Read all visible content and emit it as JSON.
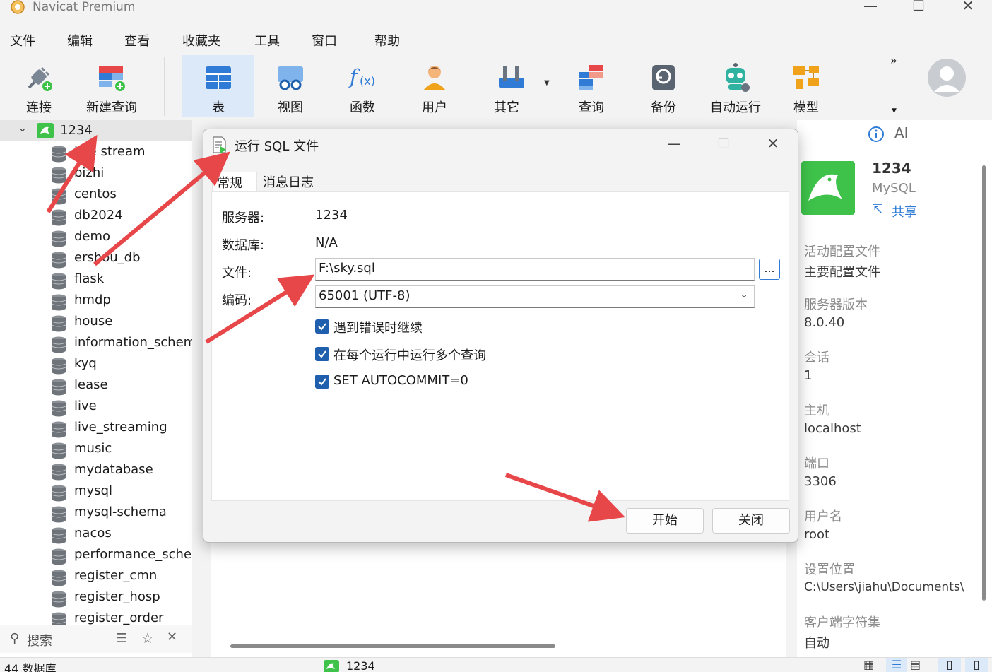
{
  "window": {
    "title": "Navicat Premium",
    "controls": [
      "—",
      "☐",
      "✕"
    ]
  },
  "menu": [
    "文件",
    "编辑",
    "查看",
    "收藏夹",
    "工具",
    "窗口",
    "帮助"
  ],
  "toolbar": {
    "items": [
      {
        "label": "连接",
        "icon": "plug-icon"
      },
      {
        "label": "新建查询",
        "icon": "new-query-icon"
      },
      {
        "label": "表",
        "icon": "table-icon",
        "active": true
      },
      {
        "label": "视图",
        "icon": "view-icon"
      },
      {
        "label": "函数",
        "icon": "function-icon"
      },
      {
        "label": "用户",
        "icon": "user-icon"
      },
      {
        "label": "其它",
        "icon": "tools-icon"
      },
      {
        "label": "查询",
        "icon": "query-icon"
      },
      {
        "label": "备份",
        "icon": "backup-icon"
      },
      {
        "label": "自动运行",
        "icon": "robot-icon"
      },
      {
        "label": "模型",
        "icon": "model-icon"
      }
    ],
    "overflow": "»"
  },
  "navigator": {
    "connection": "1234",
    "databases": [
      "live stream",
      "bizhi",
      "centos",
      "db2024",
      "demo",
      "ershou_db",
      "flask",
      "hmdp",
      "house",
      "information_schem",
      "kyq",
      "lease",
      "live",
      "live_streaming",
      "music",
      "mydatabase",
      "mysql",
      "mysql-schema",
      "nacos",
      "performance_schen",
      "register_cmn",
      "register_hosp",
      "register_order"
    ],
    "search_label": "搜索"
  },
  "info": {
    "ai_label": "AI",
    "name": "1234",
    "type": "MySQL",
    "share_label": "共享",
    "fields": [
      {
        "label": "活动配置文件",
        "value": "主要配置文件"
      },
      {
        "label": "服务器版本",
        "value": "8.0.40"
      },
      {
        "label": "会话",
        "value": "1"
      },
      {
        "label": "主机",
        "value": "localhost"
      },
      {
        "label": "端口",
        "value": "3306"
      },
      {
        "label": "用户名",
        "value": "root"
      },
      {
        "label": "设置位置",
        "value": "C:\\Users\\jiahu\\Documents\\"
      },
      {
        "label": "客户端字符集",
        "value": "自动"
      }
    ]
  },
  "dialog": {
    "title": "运行 SQL 文件",
    "tabs": [
      "常规",
      "消息日志"
    ],
    "server_label": "服务器:",
    "server_value": "1234",
    "database_label": "数据库:",
    "database_value": "N/A",
    "file_label": "文件:",
    "file_value": "F:\\sky.sql",
    "browse_label": "...",
    "encoding_label": "编码:",
    "encoding_value": "65001 (UTF-8)",
    "options": [
      {
        "label": "遇到错误时继续",
        "checked": true
      },
      {
        "label": "在每个运行中运行多个查询",
        "checked": true
      },
      {
        "label": "SET AUTOCOMMIT=0",
        "checked": true
      }
    ],
    "start_label": "开始",
    "close_label": "关闭"
  },
  "status": {
    "db_count": "44 数据库",
    "connection": "1234"
  },
  "colors": {
    "accent": "#1f5fae",
    "arrow": "#e8474a",
    "mysql_green": "#3ec24a",
    "active_tool": "#dce9f8"
  }
}
